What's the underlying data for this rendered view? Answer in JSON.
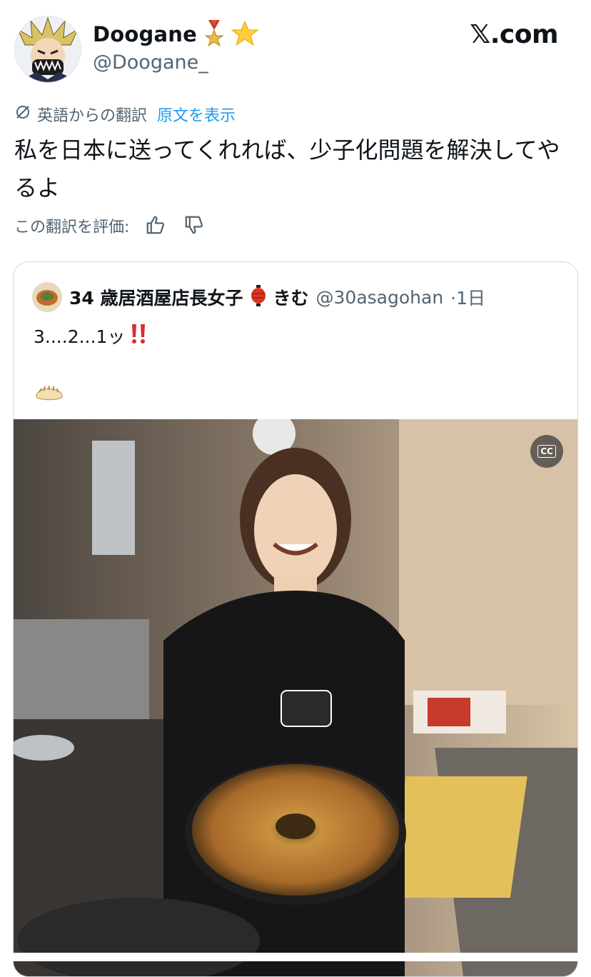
{
  "site": "𝕏.com",
  "author": {
    "display_name": "Doogane",
    "handle": "@Doogane_",
    "badges": [
      "medal-icon",
      "star-icon"
    ]
  },
  "translation": {
    "label": "英語からの翻訳",
    "show_original": "原文を表示",
    "rate_label": "この翻訳を評価:"
  },
  "tweet_text": "私を日本に送ってくれれば、少子化問題を解決してやるよ",
  "quote": {
    "display_name": "34 歳居酒屋店長女子",
    "name_suffix": "きむ",
    "handle": "@30asagohan",
    "time": "·1日",
    "text": "3....2...1ッ",
    "emphasis": "‼️",
    "emoji": "dumpling-icon",
    "media_cc": "CC"
  },
  "colors": {
    "link": "#1d9bf0",
    "secondary": "#536471",
    "border": "#cfd9de"
  }
}
